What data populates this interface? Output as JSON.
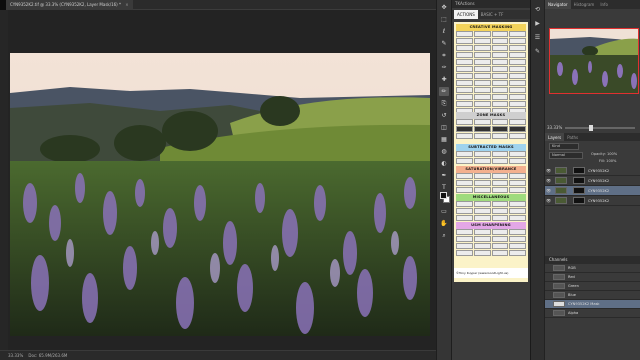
{
  "document": {
    "tab_title": "CYN9352K2.tif @ 33.3% (CYN9352K2, Layer Mask/16) *",
    "close_glyph": "×"
  },
  "tools": [
    "move-tool",
    "marquee-tool",
    "lasso-tool",
    "quick-select-tool",
    "crop-tool",
    "eyedropper-tool",
    "healing-brush-tool",
    "brush-tool",
    "clone-stamp-tool",
    "history-brush-tool",
    "eraser-tool",
    "gradient-tool",
    "blur-tool",
    "dodge-tool",
    "pen-tool",
    "type-tool",
    "path-select-tool",
    "shape-tool",
    "hand-tool",
    "zoom-tool"
  ],
  "tool_glyphs": [
    "✥",
    "⬚",
    "ℓ",
    "✎",
    "⌗",
    "✑",
    "✚",
    "✏",
    "⎘",
    "↺",
    "◫",
    "▦",
    "◍",
    "◐",
    "✒",
    "T",
    "↖",
    "▭",
    "✋",
    "⌕"
  ],
  "actions_panel": {
    "title": "TKActions",
    "tabs": [
      "ACTIONS",
      "BASIC + TF"
    ],
    "credit": "©Tony Kuyper (www.GoodLight.us)",
    "sections": [
      {
        "heading": "CREATIVE MASKING",
        "color": "#f3d35a"
      },
      {
        "heading": "ZONE MASKS",
        "color": "#cfcfcf"
      },
      {
        "heading": "SUBTRACTED MASKS",
        "color": "#9fd3ee"
      },
      {
        "heading": "SATURATION/VIBRANCE",
        "color": "#f3b08f"
      },
      {
        "heading": "MISCELLANEOUS",
        "color": "#9fdb7d"
      },
      {
        "heading": "USM SHARPENING",
        "color": "#e3a7e6"
      }
    ]
  },
  "right_panel": {
    "navigator_tabs": [
      "Navigator",
      "Histogram",
      "Info"
    ],
    "zoom_value": "33.33%",
    "layer_tabs": [
      "Layers",
      "Paths"
    ],
    "layer_kind": "Kind",
    "blend_mode": "Normal",
    "opacity_label": "Opacity:",
    "opacity_value": "100%",
    "fill_label": "Fill:",
    "fill_value": "100%",
    "layers": [
      {
        "name": "CYN9352K2",
        "selected": false
      },
      {
        "name": "CYN9352K2",
        "selected": false
      },
      {
        "name": "CYN9352K2",
        "selected": true
      },
      {
        "name": "CYN9352K2",
        "selected": false
      }
    ],
    "channels_title": "Channels",
    "channels": [
      {
        "name": "RGB",
        "selected": false
      },
      {
        "name": "Red",
        "selected": false
      },
      {
        "name": "Green",
        "selected": false
      },
      {
        "name": "Blue",
        "selected": false
      },
      {
        "name": "CYN9352K2 Mask",
        "selected": true
      },
      {
        "name": "Alpha",
        "selected": false
      }
    ]
  },
  "status": {
    "zoom": "33.33%",
    "doc_info": "Doc: 65.9M/263.6M"
  }
}
